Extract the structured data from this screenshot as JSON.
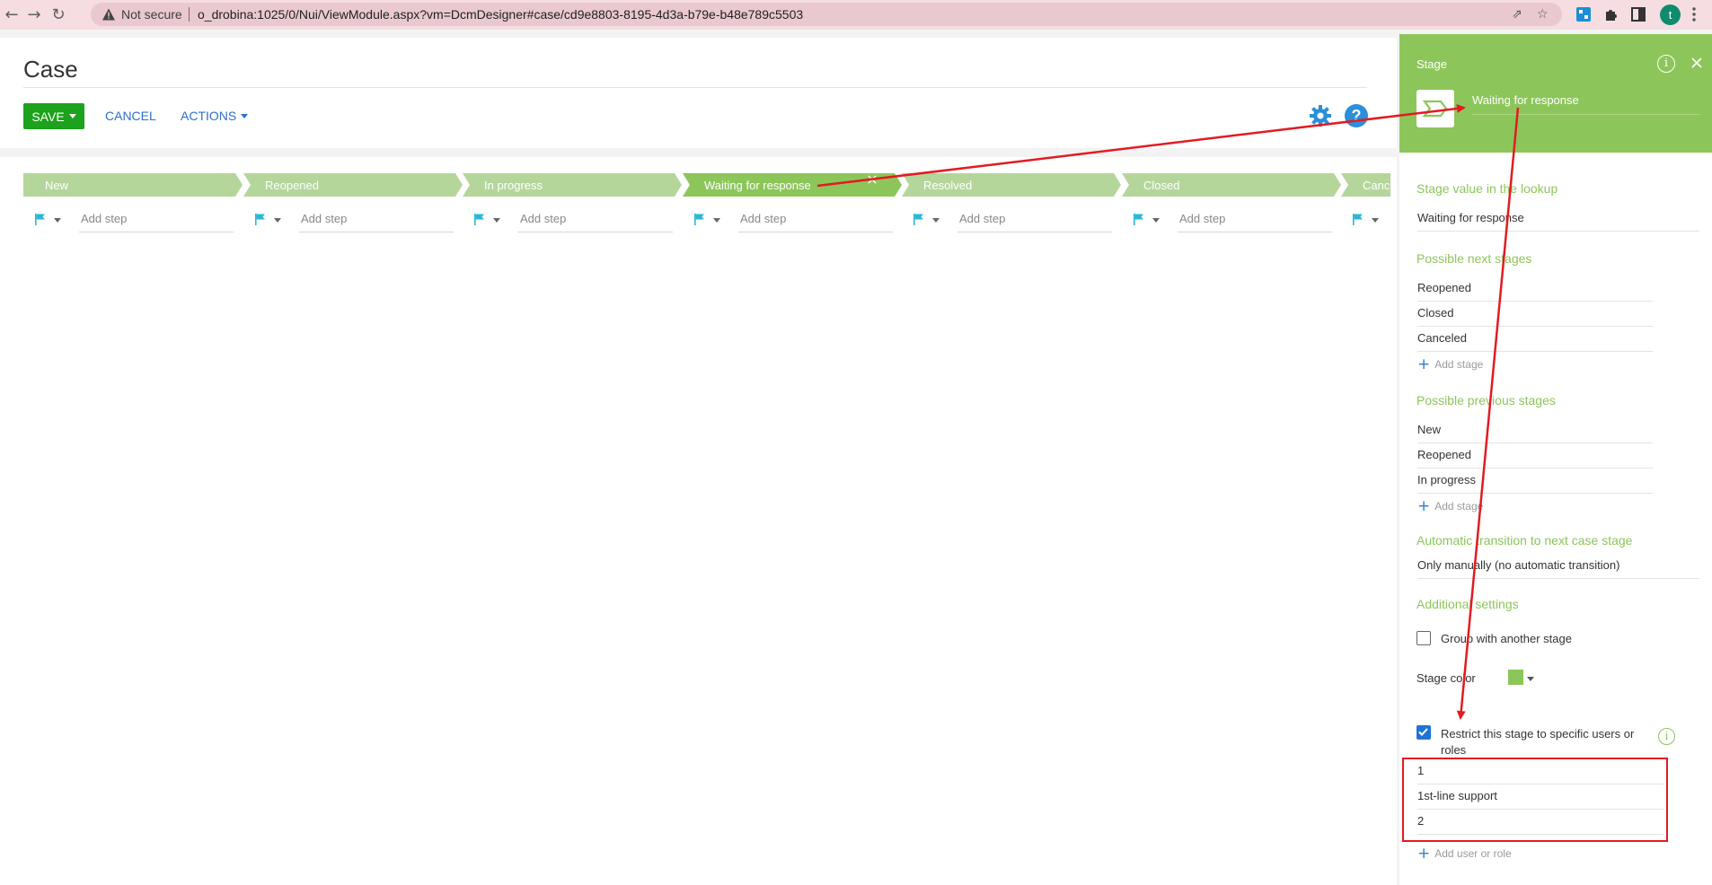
{
  "browser": {
    "security": "Not secure",
    "url": "o_drobina:1025/0/Nui/ViewModule.aspx?vm=DcmDesigner#case/cd9e8803-8195-4d3a-b79e-b48e789c5503",
    "profile_initial": "t"
  },
  "header": {
    "title": "Case",
    "save_label": "SAVE",
    "cancel_label": "CANCEL",
    "actions_label": "ACTIONS"
  },
  "stages": [
    {
      "label": "New",
      "color": "#b5d69b"
    },
    {
      "label": "Reopened",
      "color": "#b5d69b"
    },
    {
      "label": "In progress",
      "color": "#b5d69b"
    },
    {
      "label": "Waiting for response",
      "color": "#8cc65a",
      "selected": true
    },
    {
      "label": "Resolved",
      "color": "#b5d69b"
    },
    {
      "label": "Closed",
      "color": "#b5d69b"
    },
    {
      "label": "Cance",
      "color": "#b5d69b"
    }
  ],
  "step_placeholder": "Add step",
  "panel": {
    "header_label": "Stage",
    "stage_name": "Waiting for response",
    "lookup_title": "Stage value in the lookup",
    "lookup_value": "Waiting for response",
    "next_title": "Possible next stages",
    "next_stages": [
      "Reopened",
      "Closed",
      "Canceled"
    ],
    "add_stage_label": "Add stage",
    "prev_title": "Possible previous stages",
    "prev_stages": [
      "New",
      "Reopened",
      "In progress"
    ],
    "auto_title": "Automatic transition to next case stage",
    "auto_value": "Only manually (no automatic transition)",
    "additional_title": "Additional settings",
    "group_label": "Group with another stage",
    "group_checked": false,
    "color_label": "Stage color",
    "stage_color": "#8cc65a",
    "restrict_label_line1": "Restrict this stage to specific users or",
    "restrict_label_line2": "roles",
    "restrict_checked": true,
    "users": [
      "1",
      "1st-line support",
      "2"
    ],
    "add_user_label": "Add user or role"
  },
  "colors": {
    "accent_green": "#8cc65a",
    "save_green": "#1ca21c",
    "link_blue": "#2e6fc9",
    "annotation_red": "#e21b22"
  }
}
